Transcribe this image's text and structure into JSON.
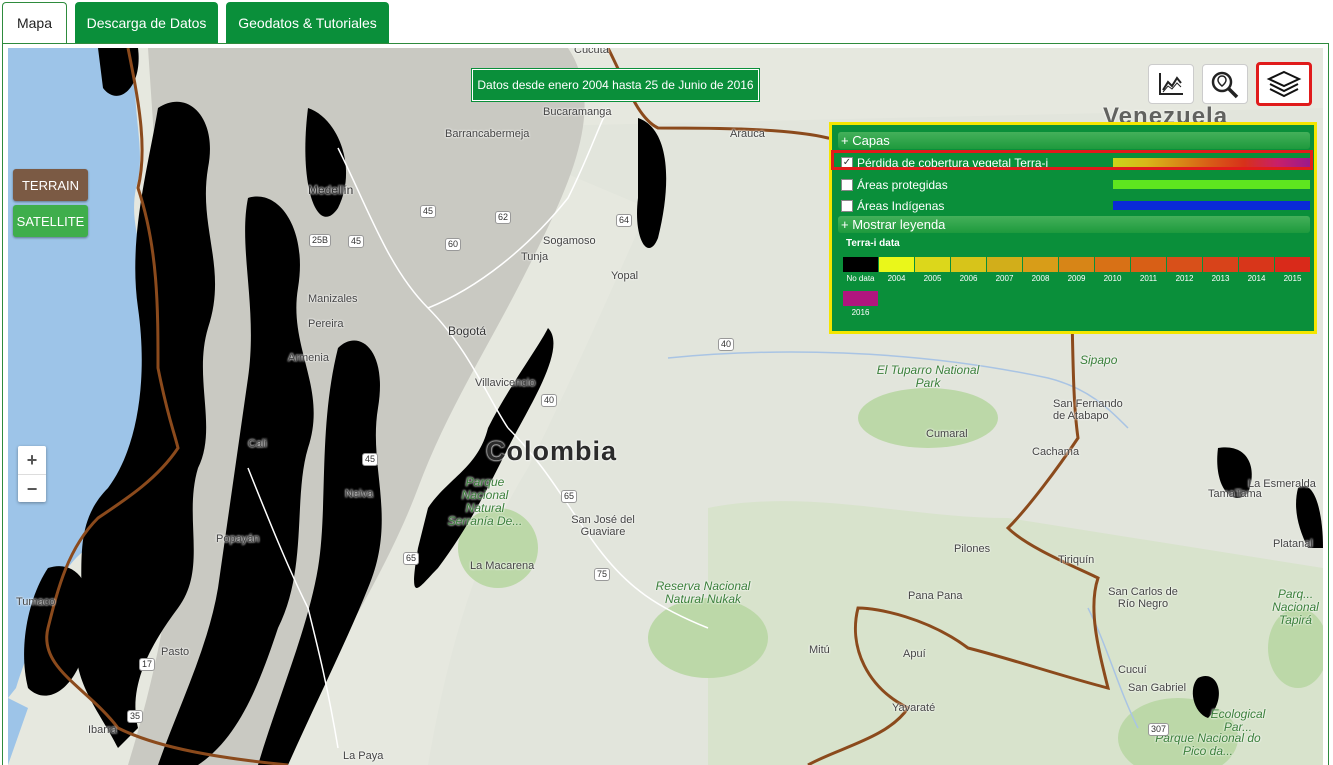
{
  "tabs": [
    {
      "label": "Mapa",
      "active": true
    },
    {
      "label": "Descarga de Datos",
      "active": false
    },
    {
      "label": "Geodatos & Tutoriales",
      "active": false
    }
  ],
  "map": {
    "date_banner": "Datos desde enero 2004 hasta 25 de Junio de 2016",
    "map_type_buttons": {
      "terrain": "TERRAIN",
      "satellite": "SATELLITE"
    },
    "zoom": {
      "in": "+",
      "out": "−"
    },
    "tools": [
      {
        "name": "chart-icon",
        "active": false
      },
      {
        "name": "search-map-icon",
        "active": false
      },
      {
        "name": "layers-icon",
        "active": true
      }
    ],
    "country_label": "Colombia",
    "partial_country_label": "Venezuela",
    "cities": [
      "Cúcuta",
      "Barrancabermeja",
      "Bucaramanga",
      "Arauca",
      "Medellín",
      "Sogamoso",
      "Tunja",
      "Yopal",
      "Manizales",
      "Pereira",
      "Armenia",
      "Bogotá",
      "Villavicencio",
      "Cali",
      "Neiva",
      "Popayán",
      "Tumaco",
      "Pasto",
      "Ibarra",
      "San José del Guaviare",
      "La Macarena",
      "Cumaral",
      "Cachama",
      "San Fernando de Atabapo",
      "TamaTama",
      "La Esmeralda",
      "Platanal",
      "Pilones",
      "Tiriquín",
      "San Carlos de Río Negro",
      "Pana Pana",
      "Mitú",
      "Apuí",
      "Yavaraté",
      "Cucuí",
      "San Gabriel",
      "La Paya",
      "Sipapo"
    ],
    "parks": [
      "El Tuparro National Park",
      "Parque Nacional Natural Serranía De...",
      "Reserva Nacional Natural Nukak",
      "Ecological Par...",
      "Parque Nacional do Pico da...",
      "Parq... Nacional Tapirá"
    ],
    "route_shields": [
      "45",
      "62",
      "64",
      "60",
      "25B",
      "45",
      "40",
      "40",
      "45",
      "65",
      "65",
      "75",
      "17",
      "35",
      "307"
    ],
    "colors": {
      "panel_green": "#0a8f3a",
      "panel_border": "#f4e600",
      "highlight": "#e01b1b",
      "terrain_btn": "#7b5a44",
      "satellite_btn": "#3fae4c",
      "border_line": "#8b4a1c"
    }
  },
  "layers_panel": {
    "section_capas": "+ Capas",
    "layers": [
      {
        "label": "Pérdida de cobertura vegetal Terra-i",
        "checked": true,
        "swatch": "gradient"
      },
      {
        "label": "Áreas protegidas",
        "checked": false,
        "swatch": "#5ee61f"
      },
      {
        "label": "Áreas Indígenas",
        "checked": false,
        "swatch": "#0a2ad8"
      }
    ],
    "section_leyenda": "+ Mostrar leyenda",
    "legend_title": "Terra-i data",
    "legend": [
      {
        "label": "No data",
        "color": "#000000"
      },
      {
        "label": "2004",
        "color": "#eaf71a"
      },
      {
        "label": "2005",
        "color": "#dcd71b"
      },
      {
        "label": "2006",
        "color": "#d7c41a"
      },
      {
        "label": "2007",
        "color": "#d2ae1a"
      },
      {
        "label": "2008",
        "color": "#d89d18"
      },
      {
        "label": "2009",
        "color": "#d78517"
      },
      {
        "label": "2010",
        "color": "#d87116"
      },
      {
        "label": "2011",
        "color": "#d85f16"
      },
      {
        "label": "2012",
        "color": "#d8501a"
      },
      {
        "label": "2013",
        "color": "#d8431a"
      },
      {
        "label": "2014",
        "color": "#d8361a"
      },
      {
        "label": "2015",
        "color": "#d92a1a"
      },
      {
        "label": "2016",
        "color": "#b0167e"
      }
    ]
  }
}
